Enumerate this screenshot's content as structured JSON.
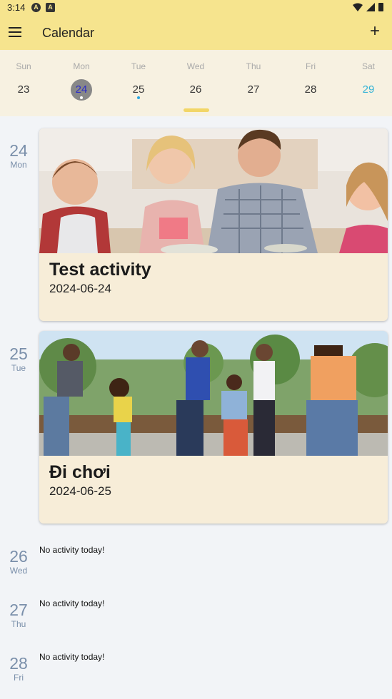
{
  "status": {
    "time": "3:14"
  },
  "appbar": {
    "title": "Calendar"
  },
  "week": [
    {
      "name": "Sun",
      "num": "23"
    },
    {
      "name": "Mon",
      "num": "24"
    },
    {
      "name": "Tue",
      "num": "25"
    },
    {
      "name": "Wed",
      "num": "26"
    },
    {
      "name": "Thu",
      "num": "27"
    },
    {
      "name": "Fri",
      "num": "28"
    },
    {
      "name": "Sat",
      "num": "29"
    }
  ],
  "agenda": [
    {
      "num": "24",
      "day": "Mon",
      "title": "Test activity",
      "date": "2024-06-24"
    },
    {
      "num": "25",
      "day": "Tue",
      "title": "Đi chơi",
      "date": "2024-06-25"
    },
    {
      "num": "26",
      "day": "Wed",
      "empty": "No activity today!"
    },
    {
      "num": "27",
      "day": "Thu",
      "empty": "No activity today!"
    },
    {
      "num": "28",
      "day": "Fri",
      "empty": "No activity today!"
    }
  ],
  "colors": {
    "appbar": "#f6e48e",
    "weekstrip": "#f7f1e1",
    "card": "#f7edd8",
    "accent_blue": "#2aa6e0",
    "date_label": "#7a8faa"
  }
}
